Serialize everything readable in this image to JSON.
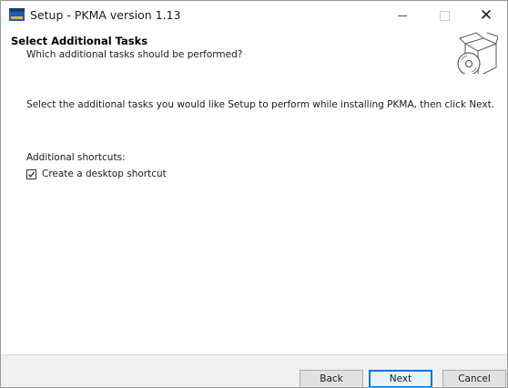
{
  "window": {
    "title": "Setup - PKMA version 1.13",
    "controls": {
      "minimize": "—",
      "maximize": "□",
      "close": "✕"
    }
  },
  "header": {
    "title": "Select Additional Tasks",
    "subtitle": "Which additional tasks should be performed?"
  },
  "content": {
    "instruction": "Select the additional tasks you would like Setup to perform while installing PKMA, then click Next.",
    "group_label": "Additional shortcuts:",
    "tasks": [
      {
        "label": "Create a desktop shortcut",
        "checked": true
      }
    ]
  },
  "footer": {
    "back_label": "Back",
    "next_label": "Next",
    "cancel_label": "Cancel"
  },
  "icons": {
    "app": "installer-app-icon",
    "header": "disc-box-icon"
  },
  "colors": {
    "accent": "#0078d7",
    "footer_bg": "#f0f0f0"
  }
}
